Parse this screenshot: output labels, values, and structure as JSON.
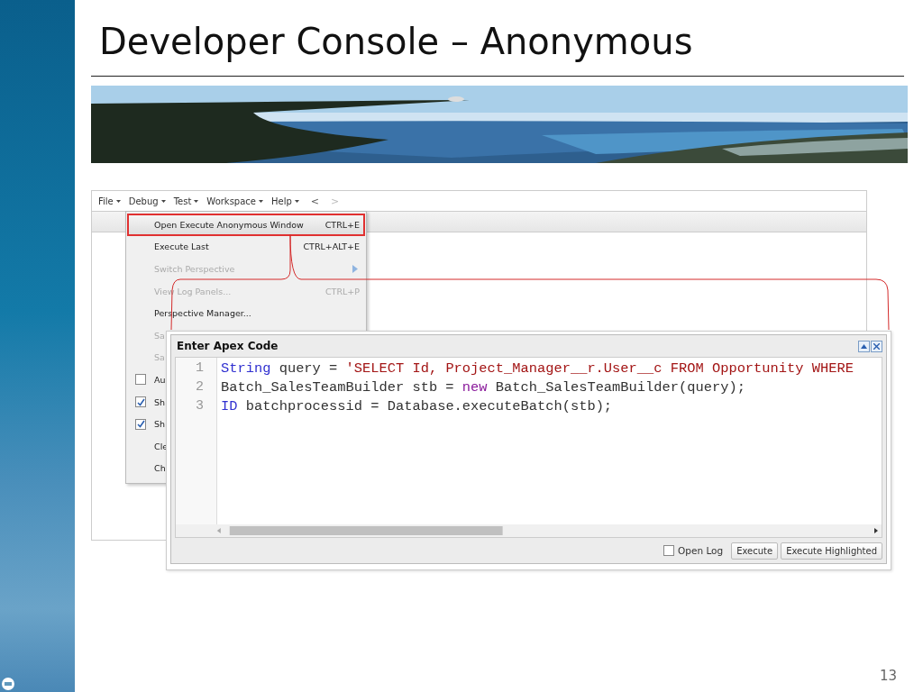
{
  "slide": {
    "title": "Developer Console – Anonymous",
    "page_number": "13"
  },
  "console": {
    "menus": [
      {
        "label": "File"
      },
      {
        "label": "Debug"
      },
      {
        "label": "Test"
      },
      {
        "label": "Workspace"
      },
      {
        "label": "Help"
      }
    ],
    "nav_buttons": [
      {
        "label": "<",
        "disabled": false
      },
      {
        "label": ">",
        "disabled": true
      }
    ],
    "dropdown": [
      {
        "kind": "command",
        "label": "Open Execute Anonymous Window",
        "shortcut": "CTRL+E",
        "disabled": false,
        "selected": true
      },
      {
        "kind": "command",
        "label": "Execute Last",
        "shortcut": "CTRL+ALT+E",
        "disabled": false,
        "selected": false
      },
      {
        "kind": "submenu",
        "label": "Switch Perspective",
        "disabled": true,
        "selected": false
      },
      {
        "kind": "command",
        "label": "View Log Panels...",
        "shortcut": "CTRL+P",
        "disabled": true,
        "selected": false
      },
      {
        "kind": "command",
        "label": "Perspective Manager...",
        "disabled": false,
        "selected": false
      },
      {
        "kind": "command",
        "label": "Sa",
        "disabled": true,
        "selected": false
      },
      {
        "kind": "command",
        "label": "Sa",
        "disabled": true,
        "selected": false
      },
      {
        "kind": "check",
        "label": "Au",
        "checked": false,
        "disabled": false,
        "selected": false
      },
      {
        "kind": "check",
        "label": "Sh",
        "checked": true,
        "disabled": false,
        "selected": false
      },
      {
        "kind": "check",
        "label": "Sh",
        "checked": true,
        "disabled": false,
        "selected": false
      },
      {
        "kind": "command",
        "label": "Cle",
        "disabled": false,
        "selected": false
      },
      {
        "kind": "command",
        "label": "Ch",
        "disabled": false,
        "selected": false
      }
    ],
    "dialog": {
      "title": "Enter Apex Code",
      "lines": [
        {
          "number": "1",
          "tokens": [
            {
              "kind": "type",
              "text": "String"
            },
            {
              "kind": "plain",
              "text": " query = "
            },
            {
              "kind": "string",
              "text": "'SELECT Id, Project_Manager__r.User__c FROM Opportunity WHERE"
            }
          ]
        },
        {
          "number": "2",
          "tokens": [
            {
              "kind": "plain",
              "text": "Batch_SalesTeamBuilder stb = "
            },
            {
              "kind": "keyword",
              "text": "new"
            },
            {
              "kind": "plain",
              "text": " Batch_SalesTeamBuilder(query);"
            }
          ]
        },
        {
          "number": "3",
          "tokens": [
            {
              "kind": "type",
              "text": "ID"
            },
            {
              "kind": "plain",
              "text": " batchprocessid = Database.executeBatch(stb);"
            }
          ]
        }
      ],
      "open_log": {
        "label": "Open Log",
        "checked": false
      },
      "buttons": [
        {
          "label": "Execute"
        },
        {
          "label": "Execute Highlighted"
        }
      ]
    }
  }
}
